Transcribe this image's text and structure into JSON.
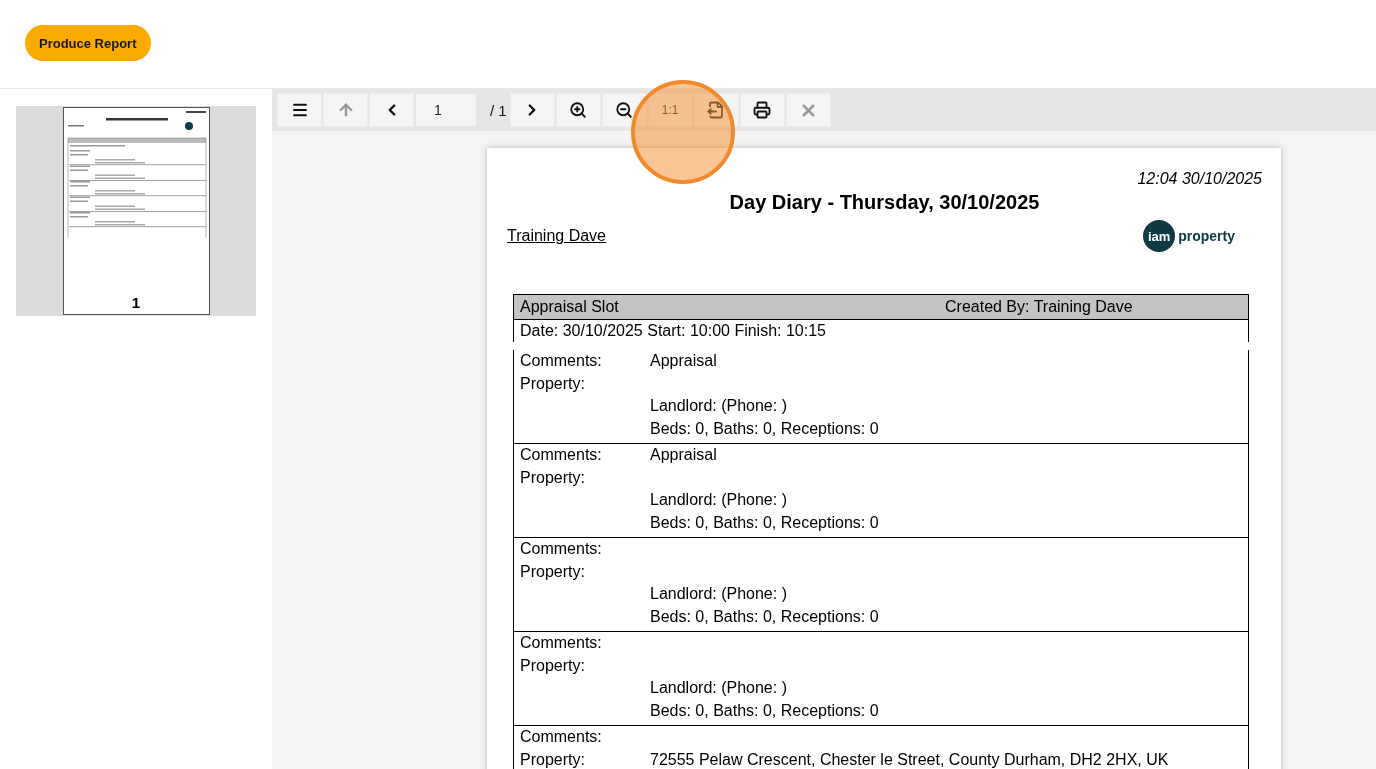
{
  "header": {
    "produce_button": "Produce Report"
  },
  "thumbnail": {
    "page_number": "1"
  },
  "toolbar": {
    "items": [
      {
        "kind": "menu",
        "disabled": false
      },
      {
        "kind": "up",
        "disabled": true
      },
      {
        "kind": "prev",
        "disabled": false
      },
      {
        "kind": "page-input",
        "value": "1"
      },
      {
        "kind": "page-count",
        "text": "/ 1"
      },
      {
        "kind": "next",
        "disabled": false
      },
      {
        "kind": "zoom-in",
        "disabled": false
      },
      {
        "kind": "zoom-out",
        "disabled": false
      },
      {
        "kind": "actual-size",
        "text": "1:1",
        "disabled": false
      },
      {
        "kind": "export",
        "disabled": false
      },
      {
        "kind": "print",
        "disabled": false
      },
      {
        "kind": "close",
        "disabled": true
      }
    ]
  },
  "report": {
    "timestamp": "12:04 30/10/2025",
    "title": "Day Diary - Thursday, 30/10/2025",
    "user": "Training Dave",
    "logo": {
      "left": "iam",
      "right": "property"
    },
    "slot": {
      "name": "Appraisal Slot",
      "created_by": "Created By: Training Dave",
      "times": "Date: 30/10/2025 Start: 10:00 Finish: 10:15"
    },
    "entries": [
      {
        "comments_label": "Comments:",
        "comments": "Appraisal",
        "property_label": "Property:",
        "landlord": "Landlord: (Phone: )",
        "rooms": "Beds: 0, Baths: 0, Receptions: 0"
      },
      {
        "comments_label": "Comments:",
        "comments": "Appraisal",
        "property_label": "Property:",
        "landlord": "Landlord: (Phone: )",
        "rooms": "Beds: 0, Baths: 0, Receptions: 0"
      },
      {
        "comments_label": "Comments:",
        "property_label": "Property:",
        "landlord": "Landlord: (Phone: )",
        "rooms": "Beds: 0, Baths: 0, Receptions: 0"
      },
      {
        "comments_label": "Comments:",
        "property_label": "Property:",
        "landlord": "Landlord: (Phone: )",
        "rooms": "Beds: 0, Baths: 0, Receptions: 0"
      },
      {
        "comments_label": "Comments:",
        "property_label": "Property:",
        "property": "72555 Pelaw Crescent, Chester le Street, County Durham, DH2 2HX, UK"
      }
    ]
  }
}
